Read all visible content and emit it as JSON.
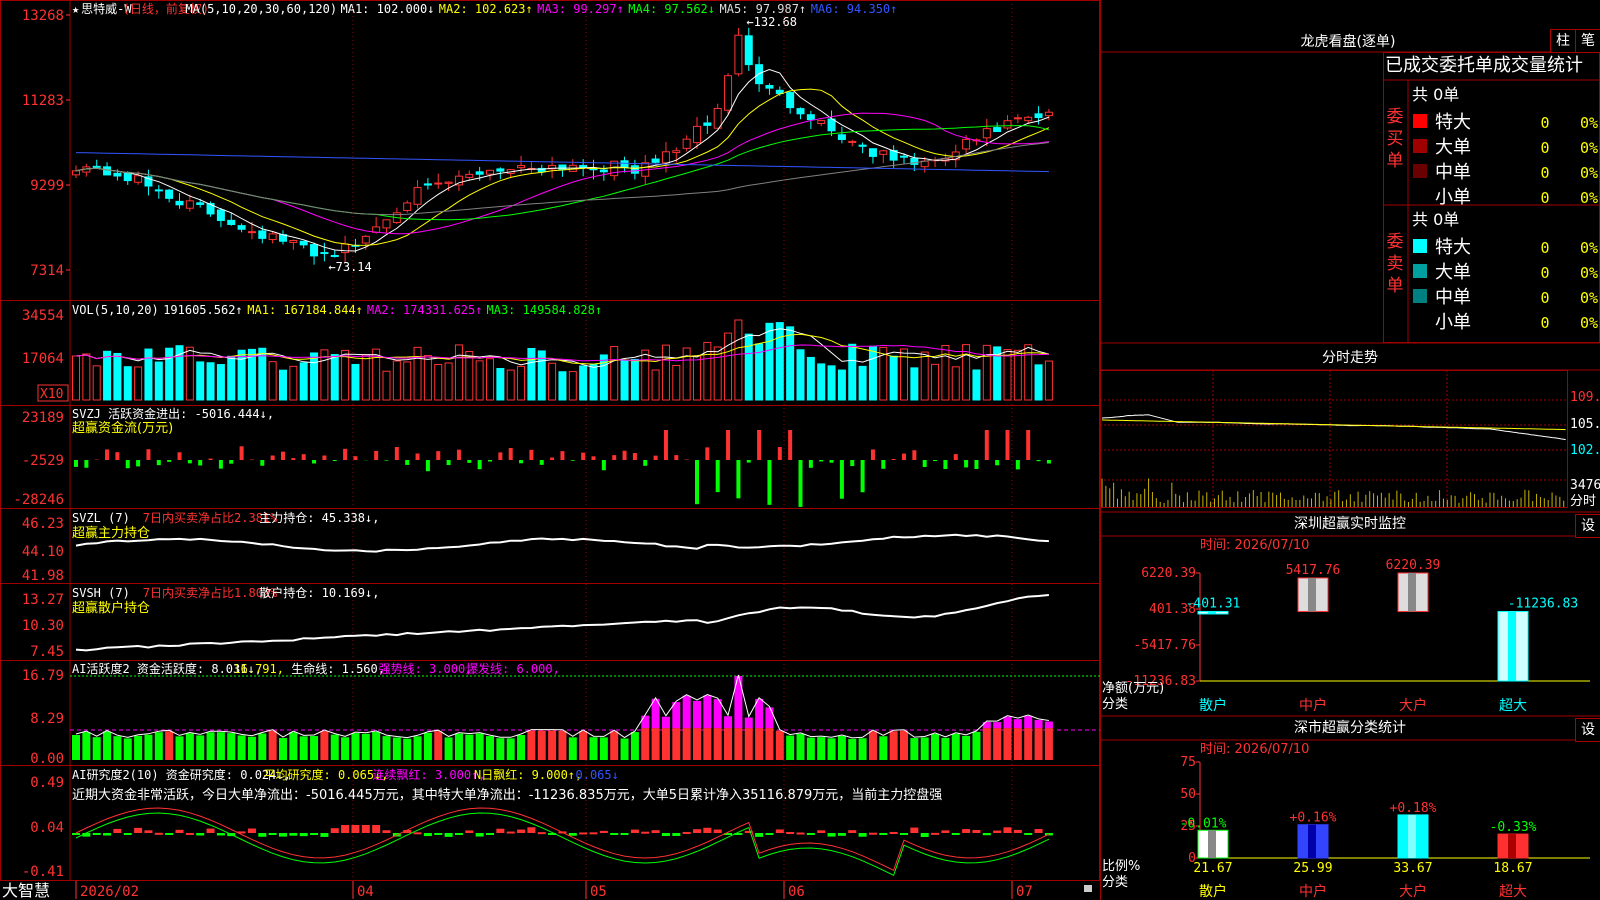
{
  "window": {
    "brand": "大智慧"
  },
  "colors": {
    "up": "#ff3232",
    "down": "#00ffff",
    "grid": "#a00000",
    "panel_border": "#a00000",
    "yellow": "#ffff00",
    "magenta": "#ff00ff",
    "green": "#00ff00",
    "white": "#ffffff",
    "blue": "#3355ff"
  },
  "kline": {
    "stock_name": "思特威-W",
    "mode": "(日线，前复权)",
    "ma_label": "MA(5,10,20,30,60,120)",
    "ma1": "MA1: 102.000↓",
    "ma2": "MA2: 102.623↑",
    "ma3": "MA3: 99.297↑",
    "ma4": "MA4: 97.562↓",
    "ma5": "MA5: 97.987↑",
    "ma6": "MA6: 94.350↑",
    "high_note": "←132.68",
    "low_note": "←73.14",
    "y_ticks": [
      "13268",
      "11283",
      "9299",
      "7314"
    ]
  },
  "volume": {
    "label": "VOL(5,10,20)",
    "value": "191605.562↑",
    "ma1": "MA1: 167184.844↑",
    "ma2": "MA2: 174331.625↑",
    "ma3": "MA3: 149584.828↑",
    "y_ticks": [
      "34554",
      "17064"
    ],
    "unit": "X10"
  },
  "svzj": {
    "label": "SVZJ  活跃资金进出: -5016.444↓,",
    "sub": "超赢资金流(万元)",
    "y_ticks": [
      "23189",
      "-2529",
      "-28246"
    ]
  },
  "svzl": {
    "label": "SVZL (7)",
    "ratio": "7日内买卖净占比2.381%",
    "hold": "主力持仓: 45.338↓,",
    "sub": "超赢主力持仓",
    "y_ticks": [
      "46.23",
      "44.10",
      "41.98"
    ]
  },
  "svsh": {
    "label": "SVSH (7)",
    "ratio": "7日内买卖净占比1.802%",
    "hold": "散户持仓: 10.169↓,",
    "sub": "超赢散户持仓",
    "y_ticks": [
      "13.27",
      "10.30",
      "7.45"
    ]
  },
  "ai_active": {
    "label": "AI活跃度2 资金活跃度: 8.031↓,",
    "v2": "16.791,",
    "life": "生命线: 1.560,",
    "strong": "强势线: 3.000,",
    "burst": "爆发线: 6.000,",
    "y_ticks": [
      "16.79",
      "8.29",
      "0.00"
    ]
  },
  "ai_research": {
    "label": "AI研究度2(10) 资金研究度: 0.024↓,",
    "avg": "平均研究度: 0.065↓,",
    "cont": "连续飘红: 3.000↑,",
    "nday": "N日飘红: 9.000↑,",
    "last": "0.065↓",
    "summary": "近期大资金非常活跃，今日大单净流出：-5016.445万元，其中特大单净流出：-11236.835万元，大单5日累计净入35116.879万元，当前主力控盘强",
    "y_ticks": [
      "0.49",
      "0.04",
      "-0.41"
    ]
  },
  "x_axis": {
    "labels": [
      "2026/02",
      "04",
      "05",
      "06",
      "07"
    ]
  },
  "right": {
    "dragon_title": "龙虎看盘(逐单)",
    "btn_bar": "柱",
    "btn_stroke": "笔",
    "stats_title": "已成交委托单成交量统计",
    "buy_side": {
      "side_label": "委买单",
      "total": "共 0单",
      "rows": [
        {
          "name": "特大",
          "val": "0",
          "pct": "0%",
          "color": "#ff0000"
        },
        {
          "name": "大单",
          "val": "0",
          "pct": "0%",
          "color": "#a00000"
        },
        {
          "name": "中单",
          "val": "0",
          "pct": "0%",
          "color": "#6a0000"
        },
        {
          "name": "小单",
          "val": "0",
          "pct": "0%",
          "color": ""
        }
      ]
    },
    "sell_side": {
      "side_label": "委卖单",
      "total": "共 0单",
      "rows": [
        {
          "name": "特大",
          "val": "0",
          "pct": "0%",
          "color": "#00ffff"
        },
        {
          "name": "大单",
          "val": "0",
          "pct": "0%",
          "color": "#00a0a0"
        },
        {
          "name": "中单",
          "val": "0",
          "pct": "0%",
          "color": "#008080"
        },
        {
          "name": "小单",
          "val": "0",
          "pct": "0%",
          "color": ""
        }
      ]
    },
    "intraday": {
      "title": "分时走势",
      "y_ticks": [
        "109.1",
        "105.8",
        "102.6",
        "3476"
      ],
      "footer": "分时"
    },
    "monitor": {
      "title": "深圳超赢实时监控",
      "btn": "设",
      "time": "时间: 2026/07/10",
      "y_ticks": [
        "6220.39",
        "401.38",
        "-5417.76",
        "-11236.83"
      ],
      "ylabel": "净额(万元)",
      "xlabel": "分类",
      "bars": [
        {
          "cat": "散户",
          "value": -401.31,
          "label": "-401.31"
        },
        {
          "cat": "中户",
          "value": 5417.76,
          "label": "5417.76"
        },
        {
          "cat": "大户",
          "value": 6220.39,
          "label": "6220.39"
        },
        {
          "cat": "超大",
          "value": -11236.83,
          "label": "-11236.83"
        }
      ]
    },
    "classify": {
      "title": "深市超赢分类统计",
      "btn": "设",
      "time": "时间: 2026/07/10",
      "y_ticks": [
        "75",
        "50",
        "25",
        "0"
      ],
      "ylabel": "比例%",
      "xlabel": "分类",
      "bars": [
        {
          "cat": "散户",
          "value": 21.67,
          "label": "21.67",
          "delta": "-0.01%",
          "color": "#ffffff"
        },
        {
          "cat": "中户",
          "value": 25.99,
          "label": "25.99",
          "delta": "+0.16%",
          "color": "#3344ff"
        },
        {
          "cat": "大户",
          "value": 33.67,
          "label": "33.67",
          "delta": "+0.18%",
          "color": "#00ffff"
        },
        {
          "cat": "超大",
          "value": 18.67,
          "label": "18.67",
          "delta": "-0.33%",
          "color": "#ff3030"
        }
      ]
    }
  }
}
